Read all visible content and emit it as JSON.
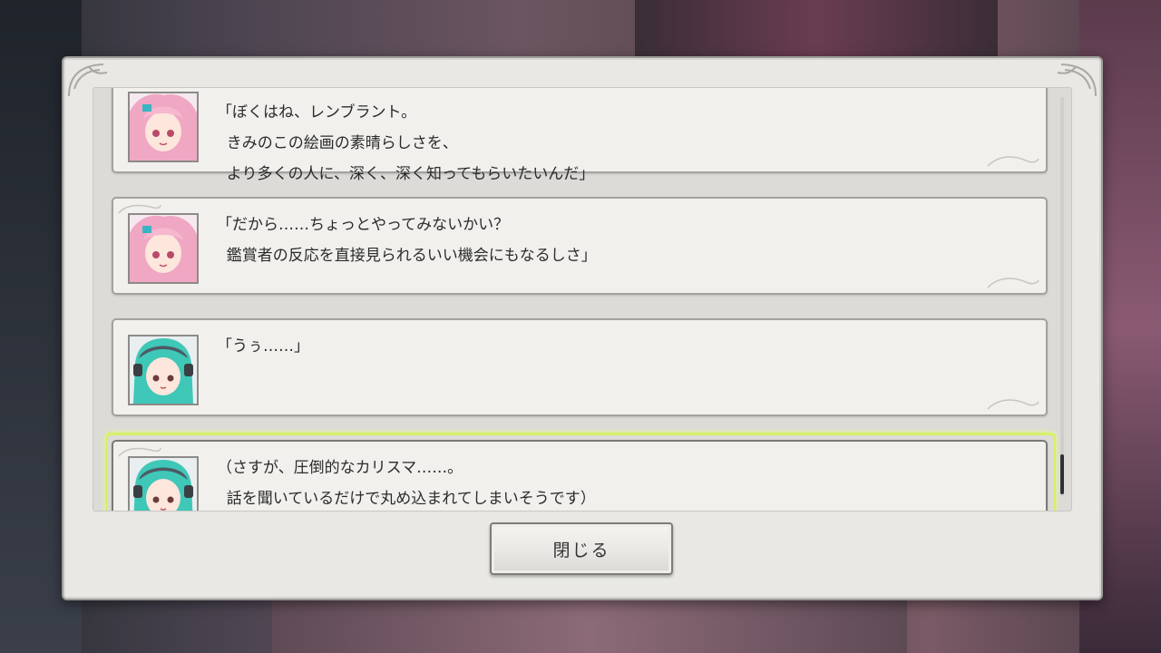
{
  "dialog": {
    "entries": [
      {
        "speaker_icon": "pink-hair-character-avatar",
        "text": "「ぼくはね、レンブラント。\n  きみのこの絵画の素晴らしさを、\n  より多くの人に、深く、深く知ってもらいたいんだ」"
      },
      {
        "speaker_icon": "pink-hair-character-avatar",
        "text": "「だから……ちょっとやってみないかい？\n  鑑賞者の反応を直接見られるいい機会にもなるしさ」"
      },
      {
        "speaker_icon": "teal-hair-character-avatar",
        "text": "「うぅ……」"
      },
      {
        "speaker_icon": "teal-hair-character-avatar",
        "text": "（さすが、圧倒的なカリスマ……。\n  話を聞いているだけで丸め込まれてしまいそうです）"
      }
    ],
    "close_label": "閉じる"
  },
  "colors": {
    "highlight": "#d8f06a",
    "panel": "#e9e8e5"
  }
}
